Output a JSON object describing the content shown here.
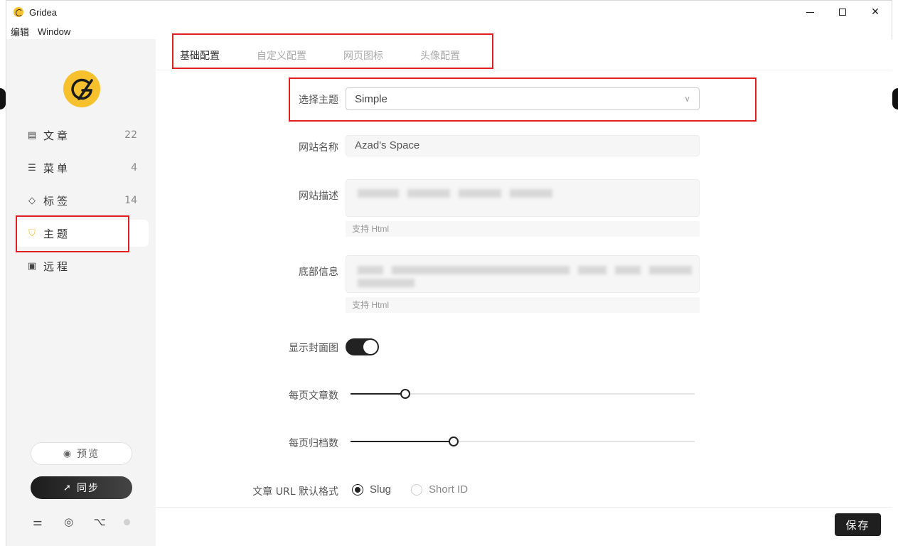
{
  "window": {
    "title": "Gridea"
  },
  "menubar": {
    "items": [
      "编辑",
      "Window"
    ]
  },
  "sidebar": {
    "items": [
      {
        "label": "文章",
        "count": "22",
        "icon": "article-icon"
      },
      {
        "label": "菜单",
        "count": "4",
        "icon": "menu-icon"
      },
      {
        "label": "标签",
        "count": "14",
        "icon": "tag-icon"
      },
      {
        "label": "主题",
        "count": "",
        "icon": "shirt-icon"
      },
      {
        "label": "远程",
        "count": "",
        "icon": "remote-icon"
      }
    ],
    "preview_label": "预览",
    "sync_label": "同步"
  },
  "tabs": [
    "基础配置",
    "自定义配置",
    "网页图标",
    "头像配置"
  ],
  "form": {
    "theme_label": "选择主题",
    "theme_value": "Simple",
    "site_name_label": "网站名称",
    "site_name_value": "Azad's Space",
    "site_desc_label": "网站描述",
    "site_desc_hint": "支持 Html",
    "footer_label": "底部信息",
    "footer_hint": "支持 Html",
    "show_cover_label": "显示封面图",
    "show_cover": true,
    "posts_per_page_label": "每页文章数",
    "posts_per_page_fraction": 0.16,
    "archives_per_page_label": "每页归档数",
    "archives_per_page_fraction": 0.3,
    "url_format_label": "文章 URL 默认格式",
    "url_options": [
      "Slug",
      "Short ID"
    ],
    "url_selected": "Slug"
  },
  "save_label": "保存",
  "colors": {
    "accent": "#f6c12c",
    "dark": "#1f1f1f",
    "highlight": "#e02020"
  }
}
